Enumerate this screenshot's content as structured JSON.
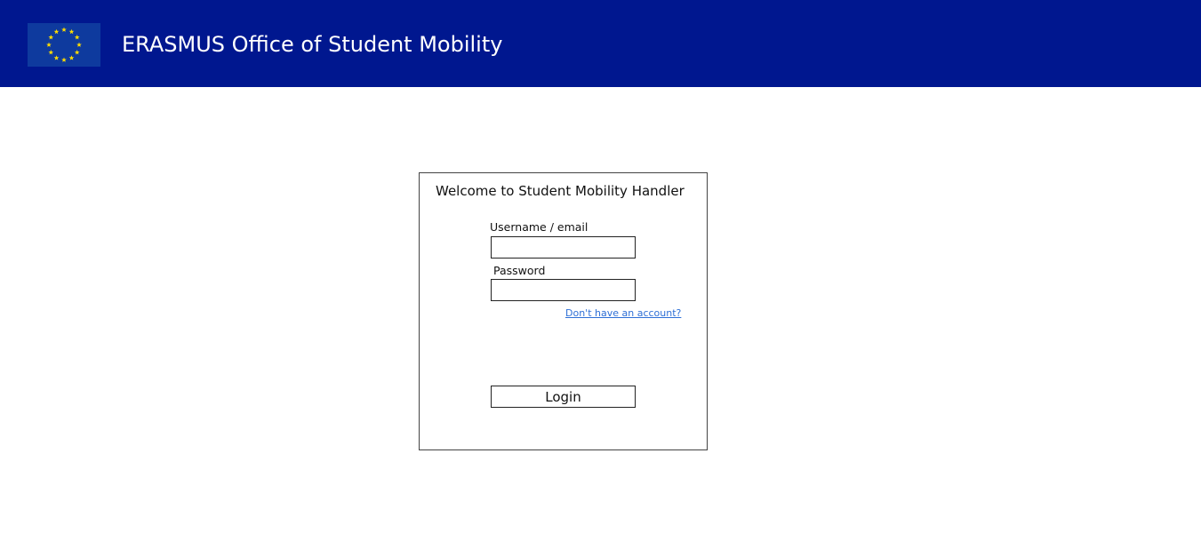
{
  "header": {
    "title": "ERASMUS Office of Student Mobility",
    "logo_icon": "eu-flag-icon",
    "colors": {
      "bar": "#00178f",
      "flag_bg": "#0e3a9e",
      "stars": "#ffdd00"
    }
  },
  "login": {
    "welcome": "Welcome to Student Mobility Handler",
    "username_label": "Username / email",
    "username_value": "",
    "password_label": "Password",
    "password_value": "",
    "signup_link": "Don't have an account?",
    "login_button": "Login",
    "link_color": "#2e6fd6"
  }
}
